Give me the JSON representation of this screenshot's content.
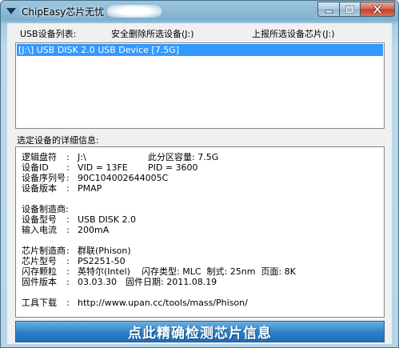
{
  "window": {
    "title": "ChipEasy芯片无忧"
  },
  "toolbar": {
    "usb_list_label": "USB设备列表:",
    "safe_remove_label": "安全删除所选设备(J:)",
    "upload_label": "上报所选设备芯片(J:)"
  },
  "device_list": {
    "items": [
      {
        "label": "[J:\\] USB DISK 2.0 USB Device [7.5G]",
        "selected": true
      }
    ]
  },
  "details": {
    "label": "选定设备的详细信息:",
    "drive_letter": {
      "key": "逻辑盘符",
      "value": "J:\\"
    },
    "partition_capacity": {
      "key": "此分区容量",
      "value": "7.5G"
    },
    "device_id": {
      "key": "设备ID",
      "value": "VID = 13FE",
      "extra": "PID = 3600"
    },
    "serial": {
      "key": "设备序列号",
      "value": "90C104002644005C"
    },
    "version": {
      "key": "设备版本",
      "value": "PMAP"
    },
    "manufacturer": {
      "key": "设备制造商",
      "value": ""
    },
    "model": {
      "key": "设备型号",
      "value": "USB DISK 2.0"
    },
    "current": {
      "key": "输入电流",
      "value": "200mA"
    },
    "chip_vendor": {
      "key": "芯片制造商",
      "value": "群联(Phison)"
    },
    "chip_model": {
      "key": "芯片型号",
      "value": "PS2251-50"
    },
    "flash": {
      "key": "闪存颗粒",
      "value": "英特尔(Intel)",
      "type_key": "闪存类型",
      "type_value": "MLC",
      "process_key": "制式",
      "process_value": "25nm",
      "page_key": "页面",
      "page_value": "8K"
    },
    "firmware": {
      "key": "固件版本",
      "value": "03.03.30",
      "date_key": "固件日期",
      "date_value": "2011.08.19"
    },
    "tool": {
      "key": "工具下载",
      "value": "http://www.upan.cc/tools/mass/Phison/"
    }
  },
  "detect_button": {
    "label": "点此精确检测芯片信息"
  },
  "colors": {
    "selection": "#3399ff",
    "button": "#2c7fc7"
  }
}
